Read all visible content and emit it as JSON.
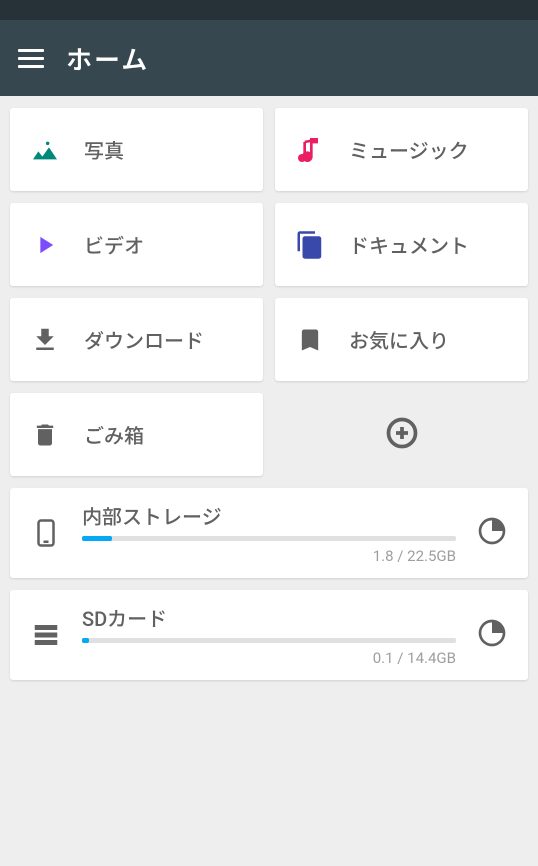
{
  "header": {
    "title": "ホーム"
  },
  "tiles": {
    "photo": {
      "label": "写真"
    },
    "music": {
      "label": "ミュージック"
    },
    "video": {
      "label": "ビデオ"
    },
    "document": {
      "label": "ドキュメント"
    },
    "download": {
      "label": "ダウンロード"
    },
    "favorite": {
      "label": "お気に入り"
    },
    "trash": {
      "label": "ごみ箱"
    }
  },
  "storage": {
    "internal": {
      "label": "内部ストレージ",
      "usage_text": "1.8 / 22.5GB",
      "percent": 8
    },
    "sdcard": {
      "label": "SDカード",
      "usage_text": "0.1 / 14.4GB",
      "percent": 1
    }
  },
  "colors": {
    "teal_icon": "#00897b",
    "pink_icon": "#e91e63",
    "purple_icon": "#7c4dff",
    "indigo_icon": "#3949ab",
    "grey_icon": "#616161",
    "progress": "#03a9f4"
  }
}
